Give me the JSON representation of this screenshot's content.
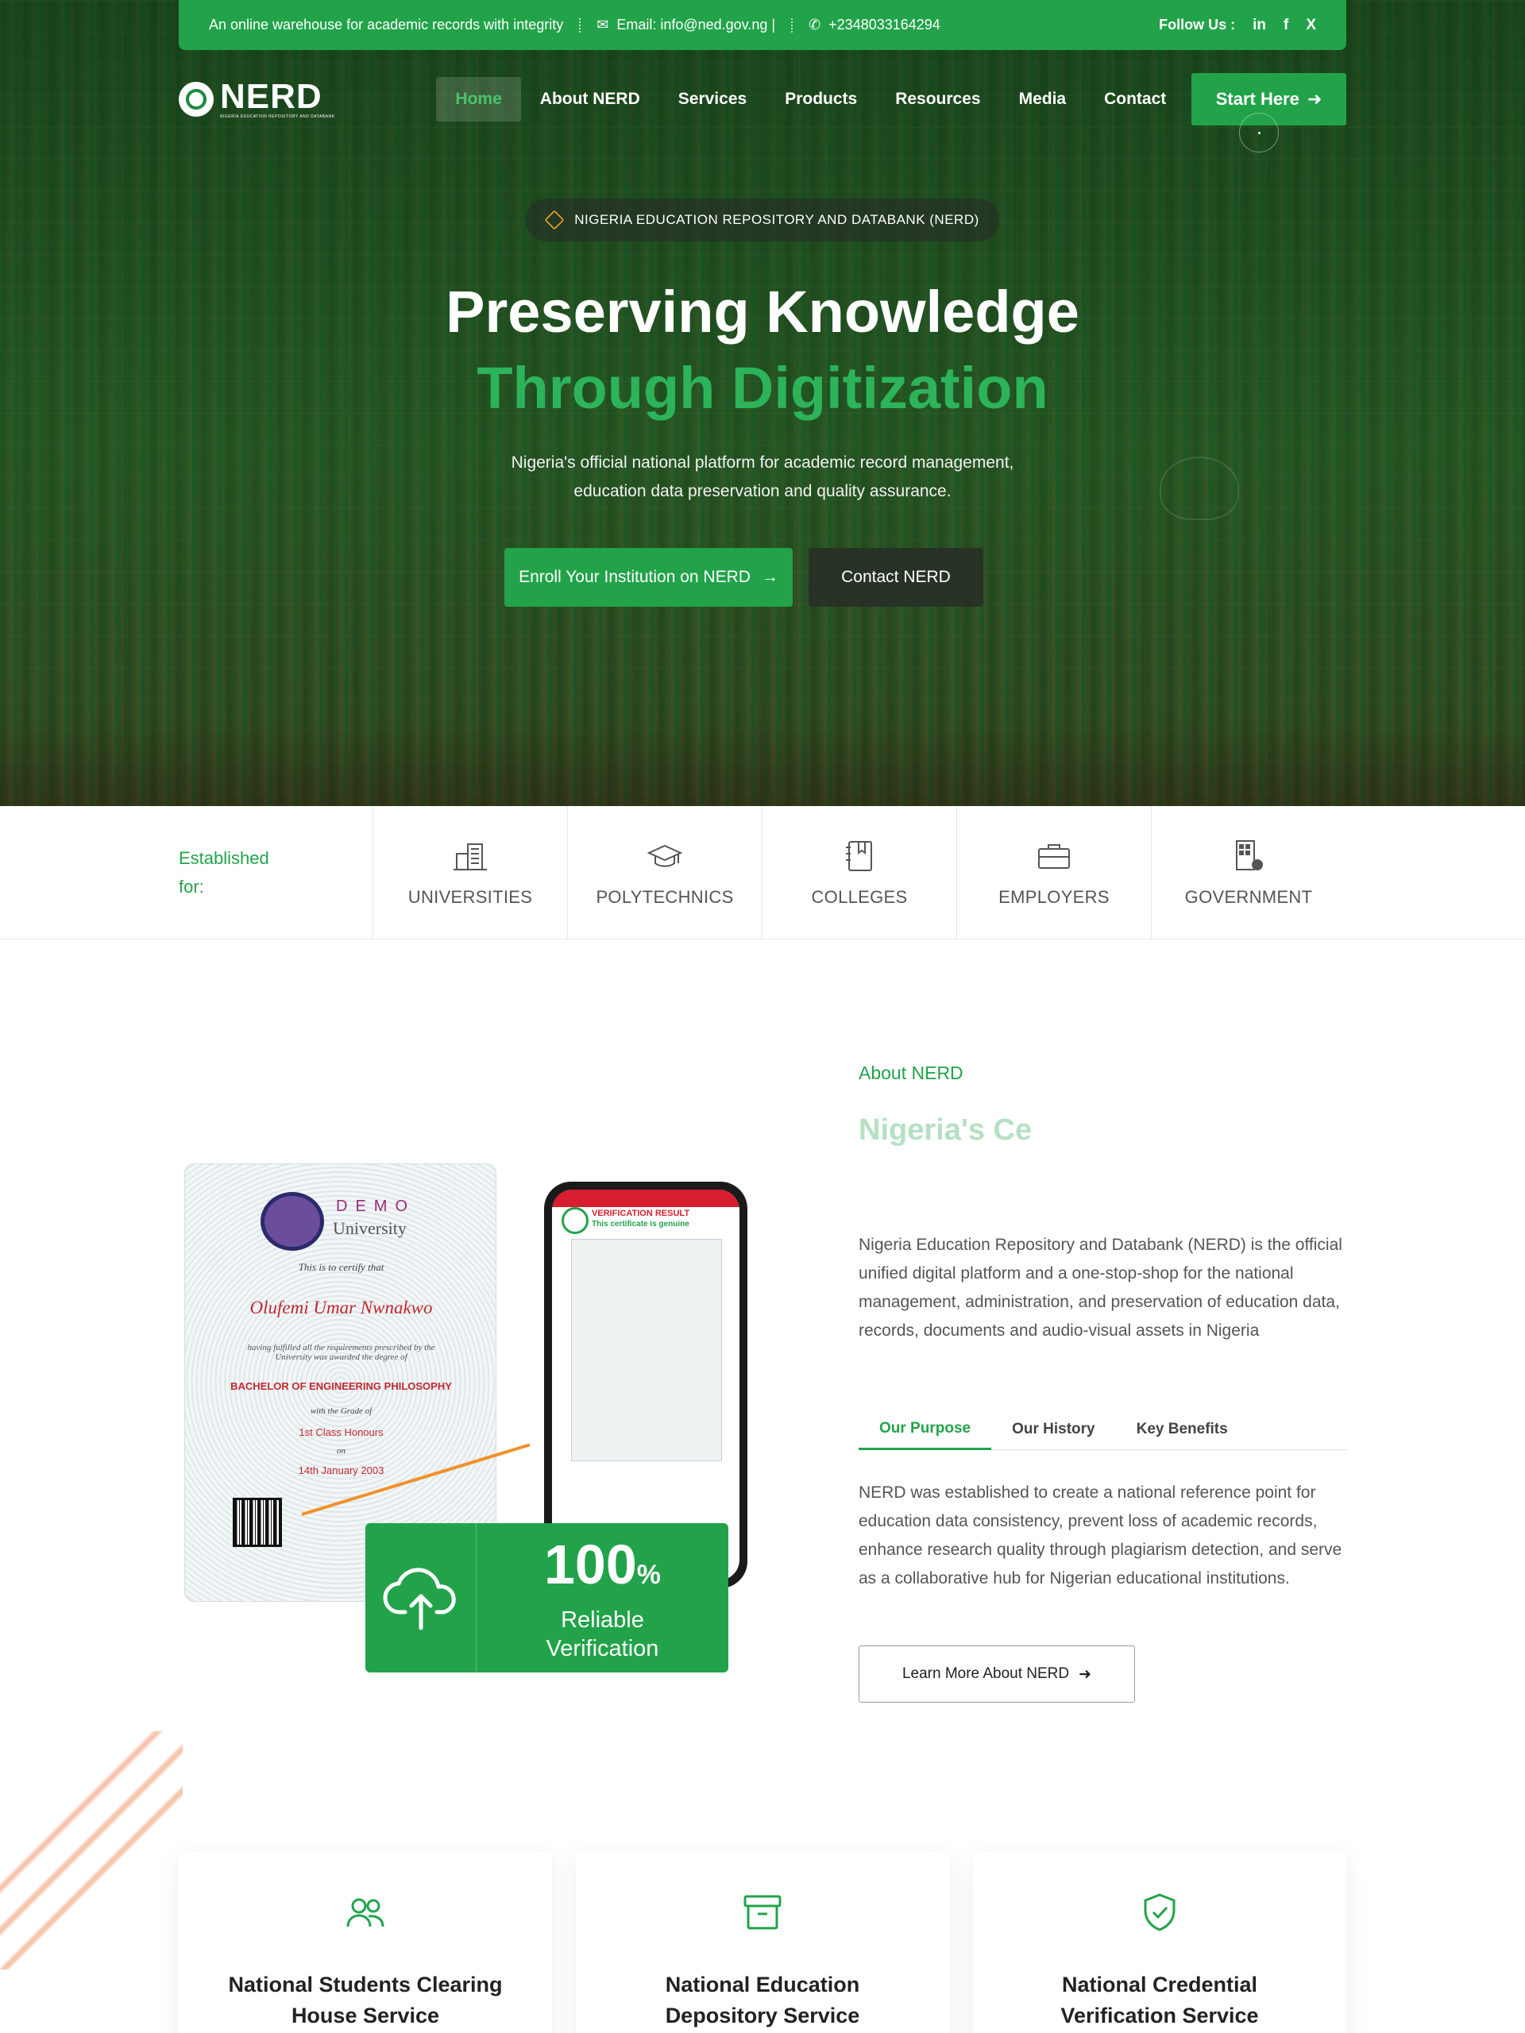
{
  "topbar": {
    "tagline": "An online warehouse for academic records with integrity",
    "email": "Email: info@ned.gov.ng |",
    "phone": "+2348033164294",
    "follow_label": "Follow Us :",
    "social": [
      "in",
      "f",
      "X"
    ]
  },
  "brand": {
    "name": "NERD",
    "subtitle": "NIGERIA EDUCATION REPOSITORY AND DATABANK"
  },
  "nav": {
    "items": [
      {
        "label": "Home",
        "active": true
      },
      {
        "label": "About NERD",
        "active": false
      },
      {
        "label": "Services",
        "active": false
      },
      {
        "label": "Products",
        "active": false
      },
      {
        "label": "Resources",
        "active": false
      },
      {
        "label": "Media",
        "active": false
      },
      {
        "label": "Contact",
        "active": false
      }
    ],
    "cta": "Start Here"
  },
  "hero": {
    "badge": "NIGERIA EDUCATION REPOSITORY AND DATABANK (NERD)",
    "title_line1": "Preserving Knowledge",
    "title_line2": "Through Digitization",
    "subtitle_line1": "Nigeria's official national platform for academic record management,",
    "subtitle_line2": "education data preservation and quality  assurance.",
    "primary_btn": "Enroll Your Institution on NERD",
    "secondary_btn": "Contact NERD"
  },
  "established": {
    "label": "Established for:",
    "items": [
      "UNIVERSITIES",
      "POLYTECHNICS",
      "COLLEGES",
      "EMPLOYERS",
      "GOVERNMENT"
    ]
  },
  "about": {
    "tag": "About NERD",
    "heading_partial": "Nigeria's Ce",
    "body": "Nigeria Education Repository and Databank (NERD) is the official unified digital platform and a one-stop-shop for the national management, administration, and preservation of education data, records, documents and audio-visual assets in Nigeria",
    "tabs": [
      {
        "label": "Our Purpose",
        "active": true
      },
      {
        "label": "Our History",
        "active": false
      },
      {
        "label": "Key Benefits",
        "active": false
      }
    ],
    "purpose": "NERD was established to create a national reference point for education data consistency, prevent loss of academic records, enhance research quality through plagiarism detection, and serve as a collaborative hub for Nigerian educational institutions.",
    "learn_btn": "Learn More About NERD"
  },
  "certificate": {
    "demo": "DEMO",
    "university": "University",
    "certify": "This is to certify that",
    "name": "Olufemi Umar Nwnakwo",
    "fulfilled": "having fulfilled all the requirements prescribed by the University was awarded the degree of",
    "degree": "BACHELOR OF ENGINEERING PHILOSOPHY",
    "grade_label": "with the Grade of",
    "grade": "1st Class Honours",
    "on": "on",
    "date": "14th January 2003"
  },
  "phone": {
    "result_title": "VERIFICATION RESULT",
    "result_status": "This certificate is genuine"
  },
  "verify_card": {
    "value": "100",
    "unit": "%",
    "line1": "Reliable",
    "line2": "Verification"
  },
  "services": [
    {
      "title": "National Students Clearing House Service",
      "icon": "users-icon"
    },
    {
      "title": "National Education Depository Service",
      "icon": "archive-icon"
    },
    {
      "title": "National Credential Verification Service",
      "icon": "shield-check-icon"
    }
  ],
  "colors": {
    "brand_green": "#22a34a",
    "accent_orange": "#f0912a",
    "cert_red": "#c0292f"
  }
}
